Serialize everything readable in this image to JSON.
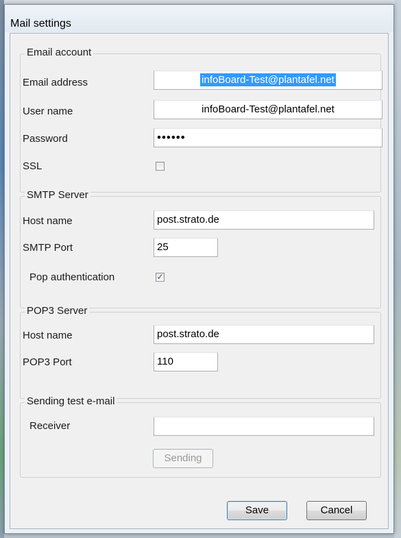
{
  "window": {
    "title": "Mail settings"
  },
  "email_account": {
    "legend": "Email account",
    "email_label": "Email address",
    "email_value": "infoBoard-Test@plantafel.net",
    "user_label": "User name",
    "user_value": "infoBoard-Test@plantafel.net",
    "password_label": "Password",
    "password_value": "••••••",
    "ssl_label": "SSL",
    "ssl_checked": false
  },
  "smtp": {
    "legend": "SMTP Server",
    "host_label": "Host name",
    "host_value": "post.strato.de",
    "port_label": "SMTP Port",
    "port_value": "25",
    "pop_auth_label": "Pop authentication",
    "pop_auth_checked": true,
    "pop_auth_mark": "✓"
  },
  "pop3": {
    "legend": "POP3 Server",
    "host_label": "Host name",
    "host_value": "post.strato.de",
    "port_label": "POP3 Port",
    "port_value": "110"
  },
  "test_mail": {
    "legend": "Sending test e-mail",
    "receiver_label": "Receiver",
    "receiver_value": "",
    "send_label": "Sending"
  },
  "buttons": {
    "save": "Save",
    "cancel": "Cancel"
  }
}
